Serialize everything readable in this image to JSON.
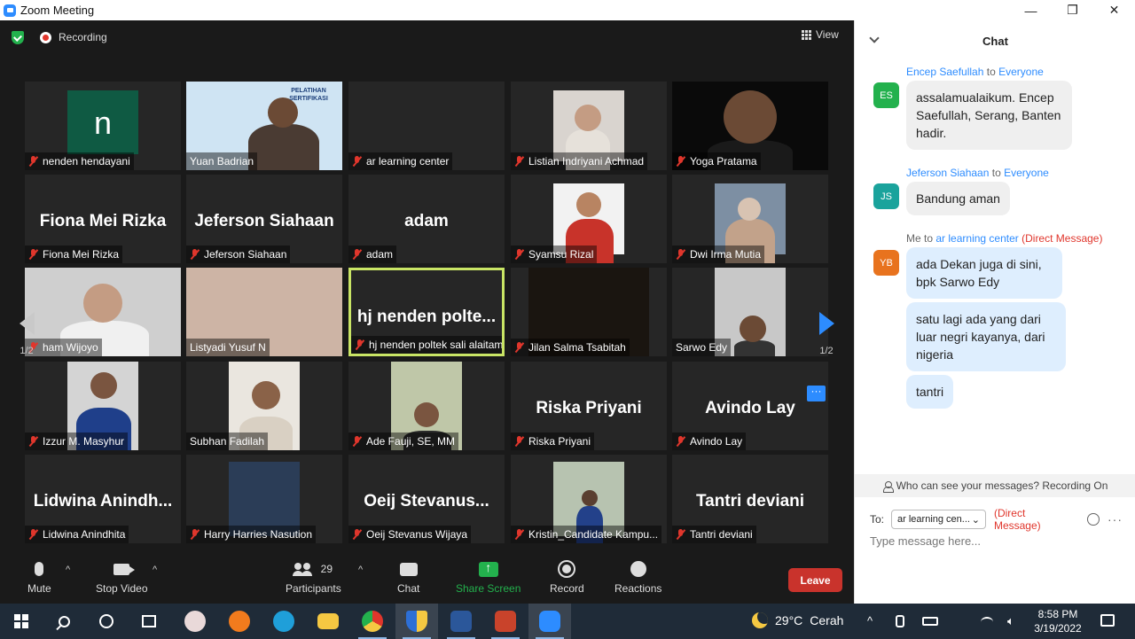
{
  "window": {
    "title": "Zoom Meeting",
    "minimize": "—",
    "restore": "❐",
    "close": "✕"
  },
  "meeting": {
    "recording_label": "Recording",
    "view_label": "View",
    "page_left": "1/2",
    "page_right": "1/2",
    "more_label": "···",
    "tiles": [
      {
        "label": "nenden hendayani",
        "display_name": "n"
      },
      {
        "label": "Yuan Badrian",
        "display_name": "",
        "banner": "PELATIHAN SERTIFIKASI"
      },
      {
        "label": "ar learning center",
        "display_name": ""
      },
      {
        "label": "Listian Indriyani Achmad",
        "display_name": ""
      },
      {
        "label": "Yoga Pratama",
        "display_name": ""
      },
      {
        "label": "Fiona Mei Rizka",
        "display_name": "Fiona Mei Rizka"
      },
      {
        "label": "Jeferson Siahaan",
        "display_name": "Jeferson Siahaan"
      },
      {
        "label": "adam",
        "display_name": "adam"
      },
      {
        "label": "Syamsu Rizal",
        "display_name": ""
      },
      {
        "label": "Dwi Irma Mutia",
        "display_name": ""
      },
      {
        "label": "ham Wijoyo",
        "display_name": ""
      },
      {
        "label": "Listyadi Yusuf N",
        "display_name": ""
      },
      {
        "label": "hj nenden poltek sali alaitam...",
        "display_name": "hj nenden polte..."
      },
      {
        "label": "Jilan Salma Tsabitah",
        "display_name": ""
      },
      {
        "label": "Sarwo Edy",
        "display_name": ""
      },
      {
        "label": "Izzur M. Masyhur",
        "display_name": ""
      },
      {
        "label": "Subhan Fadilah",
        "display_name": ""
      },
      {
        "label": "Ade Fauji, SE, MM",
        "display_name": ""
      },
      {
        "label": "Riska Priyani",
        "display_name": "Riska Priyani"
      },
      {
        "label": "Avindo Lay",
        "display_name": "Avindo Lay"
      },
      {
        "label": "Lidwina Anindhita",
        "display_name": "Lidwina Anindh..."
      },
      {
        "label": "Harry Harries  Nasution",
        "display_name": ""
      },
      {
        "label": "Oeij Stevanus Wijaya",
        "display_name": "Oeij Stevanus..."
      },
      {
        "label": "Kristin_Candidate Kampu...",
        "display_name": ""
      },
      {
        "label": "Tantri deviani",
        "display_name": "Tantri deviani"
      }
    ]
  },
  "toolbar": {
    "mute": "Mute",
    "stop_video": "Stop Video",
    "participants": "Participants",
    "participants_count": "29",
    "chat": "Chat",
    "share_screen": "Share Screen",
    "record": "Record",
    "reactions": "Reactions",
    "leave": "Leave",
    "caret": "^"
  },
  "chat": {
    "title": "Chat",
    "messages": [
      {
        "sender": "Encep Saefullah",
        "to_word": "to",
        "recipient": "Everyone",
        "initials": "ES",
        "avatar_color": "#23b14d",
        "texts": [
          "assalamualaikum. Encep Saefullah, Serang, Banten hadir."
        ]
      },
      {
        "sender": "Jeferson Siahaan",
        "to_word": "to",
        "recipient": "Everyone",
        "initials": "JS",
        "avatar_color": "#1aa39c",
        "texts": [
          "Bandung aman"
        ]
      },
      {
        "sender": "Me",
        "to_word": "to",
        "recipient": "ar learning center",
        "dm": "(Direct Message)",
        "initials": "YB",
        "avatar_color": "#e8731e",
        "texts": [
          "ada Dekan juga di sini, bpk Sarwo Edy",
          "satu lagi ada yang dari luar negri kayanya, dari nigeria",
          "tantri"
        ]
      }
    ],
    "visibility_note": "Who can see your messages? Recording On",
    "to_label": "To:",
    "to_value": "ar learning cen...",
    "to_dm": "(Direct Message)",
    "input_placeholder": "Type message here...",
    "more": "···"
  },
  "taskbar": {
    "temperature": "29°C",
    "weather": "Cerah",
    "time": "8:58 PM",
    "date": "3/19/2022",
    "chevron": "^"
  }
}
